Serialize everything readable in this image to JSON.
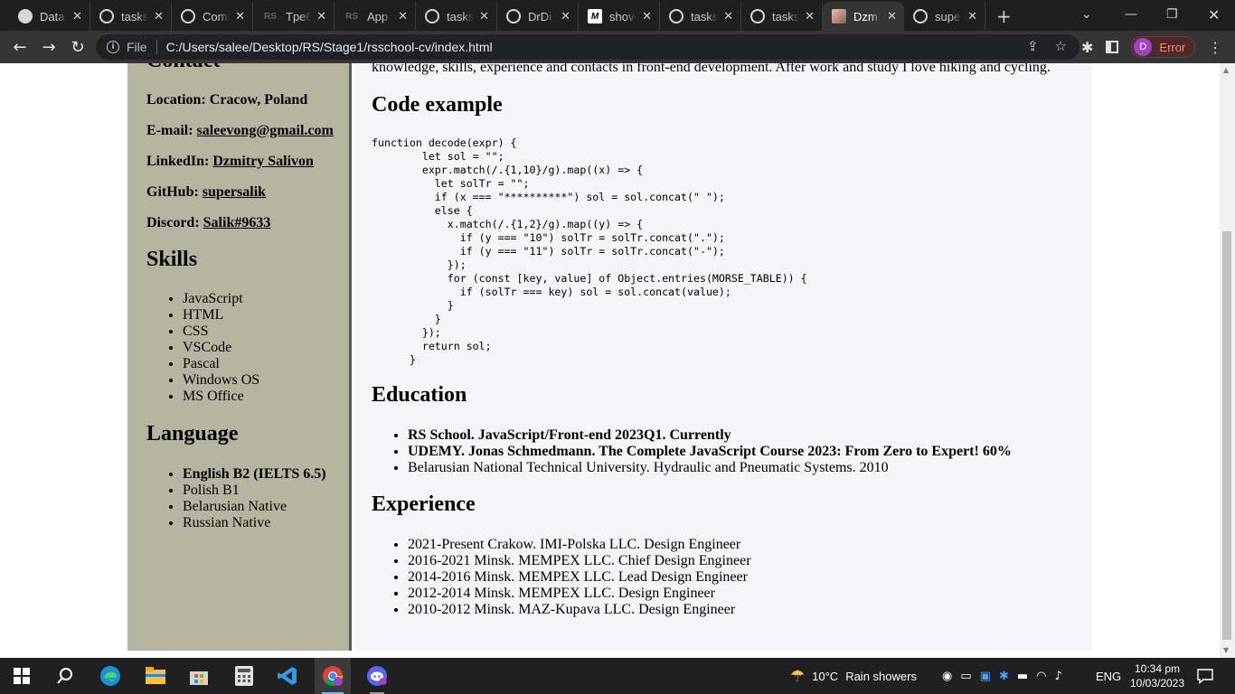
{
  "browser": {
    "tabs": [
      {
        "label": "Data",
        "favicon": "globe"
      },
      {
        "label": "tasks",
        "favicon": "github"
      },
      {
        "label": "Comp",
        "favicon": "github"
      },
      {
        "label": "Tpe6",
        "favicon": "rs"
      },
      {
        "label": "App",
        "favicon": "rs"
      },
      {
        "label": "tasks",
        "favicon": "github"
      },
      {
        "label": "DrDi",
        "favicon": "github"
      },
      {
        "label": "shove",
        "favicon": "md"
      },
      {
        "label": "tasks",
        "favicon": "github"
      },
      {
        "label": "tasks",
        "favicon": "github"
      },
      {
        "label": "Dzm",
        "favicon": "photo",
        "active": true
      },
      {
        "label": "supe",
        "favicon": "github"
      }
    ],
    "new_tab_glyph": "+",
    "address": {
      "scheme": "File",
      "url": "C:/Users/salee/Desktop/RS/Stage1/rsschool-cv/index.html"
    },
    "profile": {
      "initial": "D",
      "status": "Error"
    }
  },
  "sidebar": {
    "contact_heading": "Contact",
    "contacts": [
      {
        "label": "Location:",
        "value": "Cracow, Poland",
        "link": false
      },
      {
        "label": "E-mail:",
        "value": "saleevong@gmail.com",
        "link": true
      },
      {
        "label": "LinkedIn:",
        "value": "Dzmitry Salivon",
        "link": true
      },
      {
        "label": "GitHub:",
        "value": "supersalik",
        "link": true
      },
      {
        "label": "Discord:",
        "value": "Salik#9633",
        "link": true
      }
    ],
    "skills_heading": "Skills",
    "skills": [
      "JavaScript",
      "HTML",
      "CSS",
      "VSCode",
      "Pascal",
      "Windows OS",
      "MS Office"
    ],
    "language_heading": "Language",
    "languages": [
      {
        "text": "English B2 (IELTS 6.5)",
        "bold": true
      },
      {
        "text": "Polish B1",
        "bold": false
      },
      {
        "text": "Belarusian Native",
        "bold": false
      },
      {
        "text": "Russian Native",
        "bold": false
      }
    ]
  },
  "main": {
    "intro_tail": "knowledge, skills, experience and contacts in front-end development. After work and study I love hiking and cycling.",
    "code_heading": "Code example",
    "code": "function decode(expr) {\n        let sol = \"\";\n        expr.match(/.{1,10}/g).map((x) => {\n          let solTr = \"\";\n          if (x === \"**********\") sol = sol.concat(\" \");\n          else {\n            x.match(/.{1,2}/g).map((y) => {\n              if (y === \"10\") solTr = solTr.concat(\".\");\n              if (y === \"11\") solTr = solTr.concat(\"-\");\n            });\n            for (const [key, value] of Object.entries(MORSE_TABLE)) {\n              if (solTr === key) sol = sol.concat(value);\n            }\n          }\n        });\n        return sol;\n      }",
    "education_heading": "Education",
    "education": [
      {
        "text": "RS School. JavaScript/Front-end 2023Q1. Currently",
        "bold": true
      },
      {
        "text": "UDEMY. Jonas Schmedmann. The Complete JavaScript Course 2023: From Zero to Expert! 60%",
        "bold": true
      },
      {
        "text": "Belarusian National Technical University. Hydraulic and Pneumatic Systems. 2010",
        "bold": false
      }
    ],
    "experience_heading": "Experience",
    "experience": [
      "2021-Present Crakow. IMI-Polska LLC. Design Engineer",
      "2016-2021 Minsk. MEMPEX LLC. Chief Design Engineer",
      "2014-2016 Minsk. MEMPEX LLC. Lead Design Engineer",
      "2012-2014 Minsk. MEMPEX LLC. Design Engineer",
      "2010-2012 Minsk. MAZ-Kupava LLC. Design Engineer"
    ]
  },
  "taskbar": {
    "weather": {
      "temp": "10°C",
      "desc": "Rain showers"
    },
    "language": "ENG",
    "time": "10:34 pm",
    "date": "10/03/2023"
  },
  "colors": {
    "sidebar_bg": "#b5b5a0",
    "main_bg": "#f5f4f8",
    "chrome_dark": "#1f1f1f",
    "taskbar": "#202020"
  }
}
